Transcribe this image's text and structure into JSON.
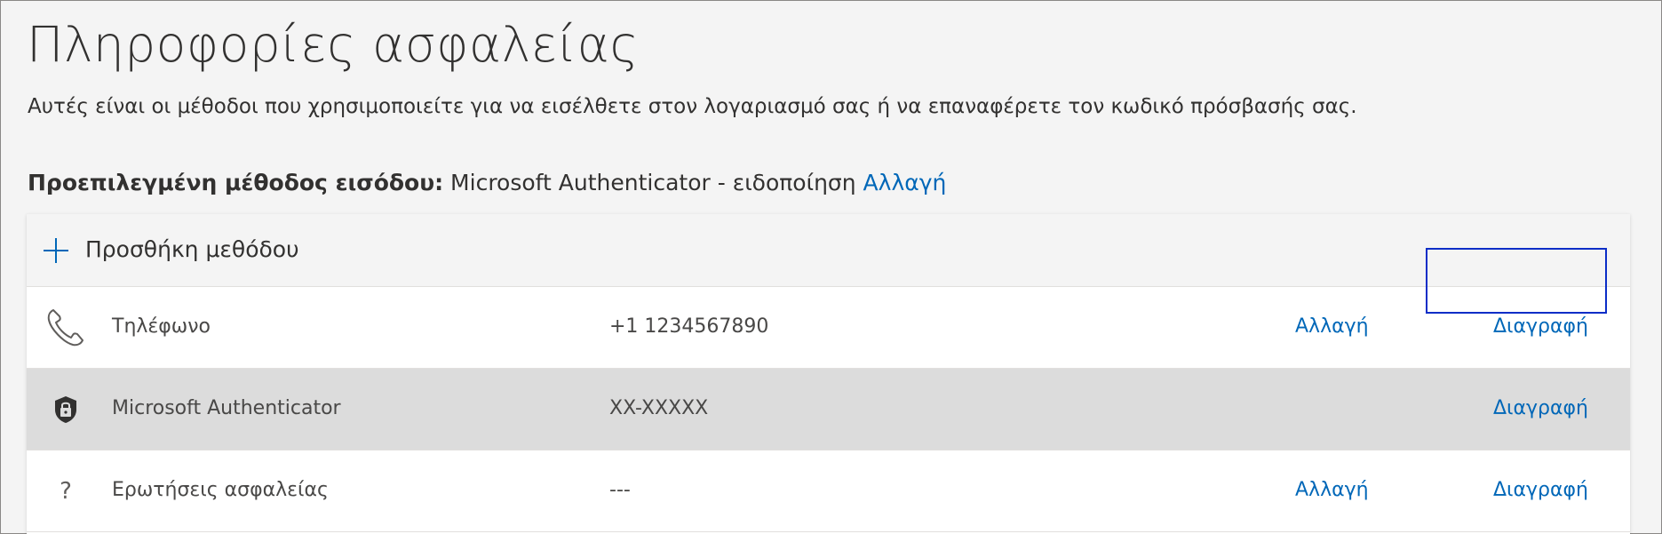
{
  "page": {
    "title": "Πληροφορίες ασφαλείας",
    "subtitle": "Αυτές είναι οι μέθοδοι που χρησιμοποιείτε για να εισέλθετε στον λογαριασμό σας ή να επαναφέρετε τον κωδικό πρόσβασής σας."
  },
  "default_method": {
    "label": "Προεπιλεγμένη μέθοδος εισόδου:",
    "value": " Microsoft Authenticator - ειδοποίηση ",
    "change_link": "Αλλαγή"
  },
  "add_method": {
    "label": "Προσθήκη μεθόδου",
    "icon": "plus-icon"
  },
  "methods": [
    {
      "name": "Τηλέφωνο",
      "value": "+1 1234567890",
      "change": "Αλλαγή",
      "delete": "Διαγραφή",
      "icon": "phone-icon"
    },
    {
      "name": "Microsoft Authenticator",
      "value": "XX-XXXXX",
      "change": "",
      "delete": "Διαγραφή",
      "icon": "authenticator-lock-icon"
    },
    {
      "name": "Ερωτήσεις ασφαλείας",
      "value": "---",
      "change": "Αλλαγή",
      "delete": "Διαγραφή",
      "icon": "question-icon"
    }
  ],
  "colors": {
    "link": "#0067b8",
    "focus": "#0b2dc7",
    "selected_row": "#dcdcdc"
  }
}
